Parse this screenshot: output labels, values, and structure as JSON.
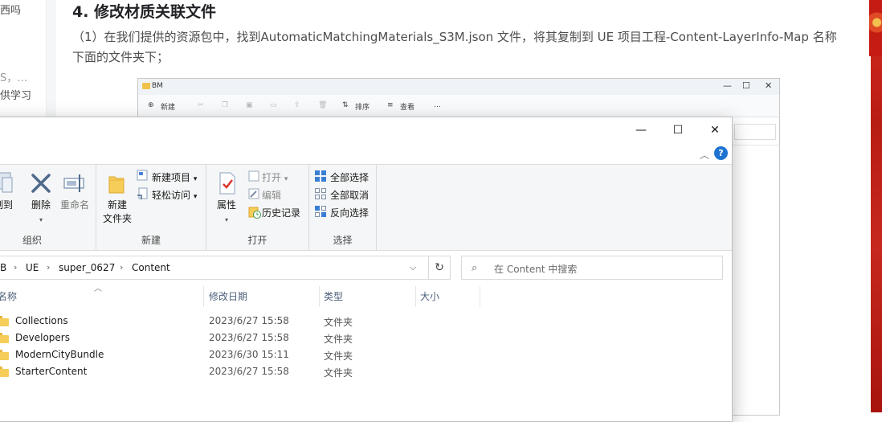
{
  "article": {
    "heading": "4. 修改材质关联文件",
    "paragraph": "（1）在我们提供的资源包中，找到AutomaticMatchingMaterials_S3M.json 文件，将其复制到 UE 项目工程-Content-LayerInfo-Map 名称下面的文件夹下；"
  },
  "sidebar_snippets": [
    "西吗",
    "S，…",
    "供学习"
  ],
  "bg_window": {
    "title": "BM",
    "commands": [
      "新建",
      "排序",
      "查看",
      "…"
    ],
    "window_controls": [
      "—",
      "☐",
      "✕"
    ]
  },
  "explorer": {
    "window_controls": {
      "minimize": "—",
      "maximize": "☐",
      "close": "✕"
    },
    "help": "?",
    "ribbon": {
      "organize": {
        "label": "组织",
        "copy_to": "制到",
        "delete": "删除",
        "rename": "重命名"
      },
      "new": {
        "label": "新建",
        "new_folder": "新建\n文件夹",
        "new_item": "新建项目",
        "easy_access": "轻松访问"
      },
      "open": {
        "label": "打开",
        "properties": "属性",
        "open": "打开",
        "edit": "编辑",
        "history": "历史记录"
      },
      "select": {
        "label": "选择",
        "select_all": "全部选择",
        "select_none": "全部取消",
        "invert": "反向选择"
      }
    },
    "address": {
      "crumbs": [
        "B",
        "UE",
        "super_0627",
        "Content"
      ]
    },
    "search": {
      "placeholder": "在 Content 中搜索"
    },
    "columns": {
      "name": "名称",
      "date": "修改日期",
      "type": "类型",
      "size": "大小"
    },
    "files": [
      {
        "name": "Collections",
        "date": "2023/6/27 15:58",
        "type": "文件夹"
      },
      {
        "name": "Developers",
        "date": "2023/6/27 15:58",
        "type": "文件夹"
      },
      {
        "name": "ModernCityBundle",
        "date": "2023/6/30 15:11",
        "type": "文件夹"
      },
      {
        "name": "StarterContent",
        "date": "2023/6/27 15:58",
        "type": "文件夹"
      }
    ]
  },
  "colors": {
    "accent_blue": "#1e73d2",
    "folder_yellow": "#f6cd58",
    "brand_red": "#c6281d"
  }
}
